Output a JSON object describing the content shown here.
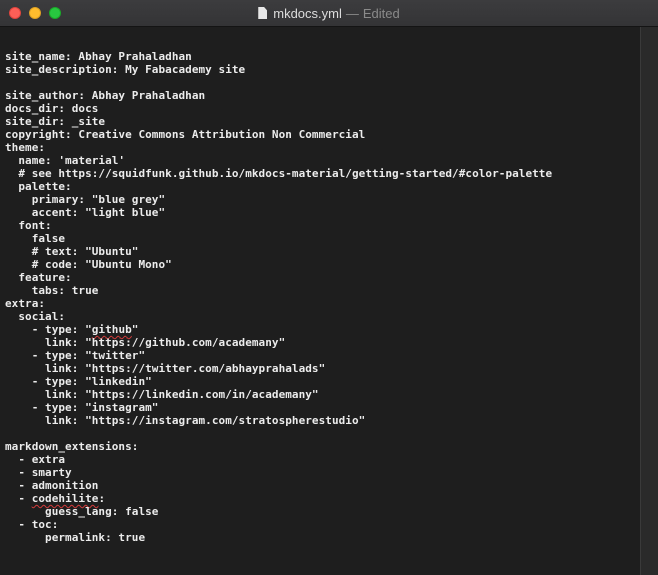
{
  "window": {
    "filename": "mkdocs.yml",
    "separator": "—",
    "status": "Edited"
  },
  "editor": {
    "lines": [
      "",
      "site_name: Abhay Prahaladhan",
      "site_description: My Fabacademy site",
      "",
      "site_author: Abhay Prahaladhan",
      "docs_dir: docs",
      "site_dir: _site",
      "copyright: Creative Commons Attribution Non Commercial",
      "theme:",
      "  name: 'material'",
      "  # see https://squidfunk.github.io/mkdocs-material/getting-started/#color-palette",
      "  palette:",
      "    primary: \"blue grey\"",
      "    accent: \"light blue\"",
      "  font:",
      "    false",
      "    # text: \"Ubuntu\"",
      "    # code: \"Ubuntu Mono\"",
      "  feature:",
      "    tabs: true",
      "extra:",
      "  social:",
      "    - type: \"github\"",
      "      link: \"https://github.com/academany\"",
      "    - type: \"twitter\"",
      "      link: \"https://twitter.com/abhayprahalads\"",
      "    - type: \"linkedin\"",
      "      link: \"https://linkedin.com/in/academany\"",
      "    - type: \"instagram\"",
      "      link: \"https://instagram.com/stratospherestudio\"",
      "",
      "markdown_extensions:",
      "  - extra",
      "  - smarty",
      "  - admonition",
      "  - codehilite:",
      "      guess_lang: false",
      "  - toc:",
      "      permalink: true"
    ]
  },
  "colors": {
    "background": "#1e1e1e",
    "text": "#ececec",
    "spellcheck": "#d33b3b"
  }
}
